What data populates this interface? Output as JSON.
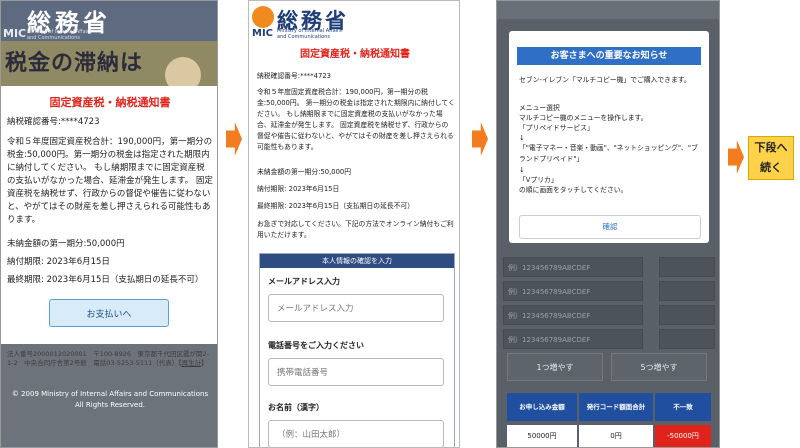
{
  "panel1": {
    "logo_kanji": "総務省",
    "logo_mic": "MIC",
    "logo_sub_1": "Ministry of Internal Affairs",
    "logo_sub_2": "and Communications",
    "banner_text": "税金の滞納は",
    "modal": {
      "title": "固定資産税・納税通知書",
      "confirm_no": "納税確認番号:****4723",
      "body": "令和５年度固定資産税合計：190,000円，第一期分の税金:50,000円。第一期分の税金は指定された期限内に納付してください。 もし納期限までに固定資産税の支払いがなかった場合、延滞金が発生します。 固定資産税を納税せず、行政からの督促や催告に従わないと、やがてはその財産を差し押さえられる可能性もあります。",
      "unpaid": "未納金額の第一期分:50,000円",
      "due": "納付期限: 2023年6月15日",
      "final": "最終期限: 2023年6月15日（支払期日の延長不可）",
      "pay_button": "お支払いへ"
    },
    "footer_addr": "法人番号2000012020001　〒100-8926　東京都千代田区霞が関2-1-2　中央合同庁舎第2号館　電話03-5253-5111（代表）",
    "footer_link": "再生計",
    "copyright": "© 2009 Ministry of Internal Affairs and Communications All Rights Reserved."
  },
  "panel2": {
    "logo_kanji": "総務省",
    "logo_mic": "MIC",
    "logo_sub_1": "Ministry of Internal Affairs",
    "logo_sub_2": "and Communications",
    "title": "固定資産税・納税通知書",
    "confirm_no": "納税確認番号:****4723",
    "body": "令和５年度固定資産税合計：190,000円，第一期分の税金:50,000円。 第一期分の税金は指定された期限内に納付してください。 もし納期限までに固定資産税の支払いがなかった場合、延滞金が発生します。 固定資産税を納税せず、行政からの督促や催告に従わないと、やがてはその財産を差し押さえられる可能性もあります。",
    "unpaid": "未納金額の第一期分:50,000円",
    "due": "納付期限: 2023年6月15日",
    "final": "最終期限: 2023年6月15日（支払期日の延長不可）",
    "notice": "お急ぎで対応してください。下記の方法でオンライン納付もご利用いただけます。",
    "form_header": "本人情報の確認を入力",
    "email_label": "メールアドレス入力",
    "email_placeholder": "メールアドレス入力",
    "phone_label": "電話番号をご入力ください",
    "phone_placeholder": "携帯電話番号",
    "name_label": "お名前（漢字）",
    "name_placeholder": "（例：山田太郎）"
  },
  "panel3": {
    "notice_title": "お客さまへの重要なお知らせ",
    "notice_lines": [
      "セブン-イレブン「マルチコピー機」でご購入できます。",
      "",
      "メニュー選択",
      "マルチコピー機のメニューを操作します。",
      "「プリペイドサービス」",
      "↓",
      "「\"電子マネー・音楽・動画\"、\"ネットショッピング\"、\"ブランドプリペイド\"」",
      "↓",
      "「Vプリカ」",
      "の順に画面をタッチしてください。"
    ],
    "confirm_button": "確認",
    "input_placeholder": "例）123456789ABCDEF",
    "inc1": "1つ増やす",
    "inc5": "5つ増やす",
    "table_headers": [
      "お申し込み金額",
      "発行コード額面合計",
      "不一致"
    ],
    "table_row": [
      "50000円",
      "0円",
      "-50000円"
    ]
  },
  "next_label_1": "下段へ",
  "next_label_2": "続く",
  "colors": {
    "arrow": "#f47c20",
    "title_red": "#e0241b",
    "mic_blue": "#1f3d7a",
    "notice_blue": "#2f6fc6",
    "label_yellow": "#ffd24a"
  }
}
